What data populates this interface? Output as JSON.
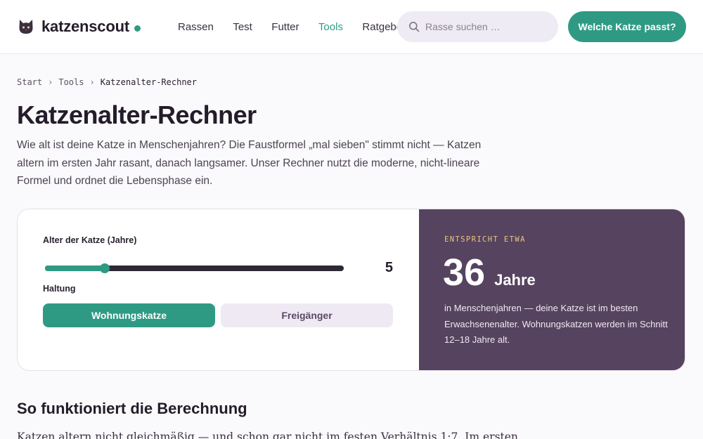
{
  "header": {
    "brand": "katzenscout",
    "nav": [
      "Rassen",
      "Test",
      "Futter",
      "Tools",
      "Ratgeber"
    ],
    "active_nav": "Tools",
    "search_placeholder": "Rasse suchen …",
    "cta_label": "Welche Katze passt?"
  },
  "breadcrumb": {
    "items": [
      "Start",
      "Tools"
    ],
    "current": "Katzenalter-Rechner",
    "separator": "›"
  },
  "page": {
    "title": "Katzenalter-Rechner",
    "intro": "Wie alt ist deine Katze in Menschenjahren? Die Faustformel „mal sieben\" stimmt nicht — Katzen altern im ersten Jahr rasant, danach langsamer. Unser Rechner nutzt die moderne, nicht-lineare Formel und ordnet die Lebensphase ein."
  },
  "calculator": {
    "age_label": "Alter der Katze (Jahre)",
    "age_value": "5",
    "slider_fraction": 0.2,
    "housing_label": "Haltung",
    "options": {
      "indoor": "Wohnungskatze",
      "outdoor": "Freigänger"
    },
    "selected": "indoor"
  },
  "result": {
    "kicker": "ENTSPRICHT ETWA",
    "value": "36",
    "unit": "Jahre",
    "description": "in Menschenjahren — deine Katze ist im besten Erwachsenenalter. Wohnungskatzen werden im Schnitt 12–18 Jahre alt."
  },
  "section": {
    "title": "So funktioniert die Berechnung",
    "text": "Katzen altern nicht gleichmäßig — und schon gar nicht im festen Verhältnis 1:7. Im ersten"
  },
  "colors": {
    "accent": "#2f9a84",
    "result_panel": "#56435f",
    "kicker": "#e9c77b",
    "toggle_inactive": "#efe9f4"
  }
}
